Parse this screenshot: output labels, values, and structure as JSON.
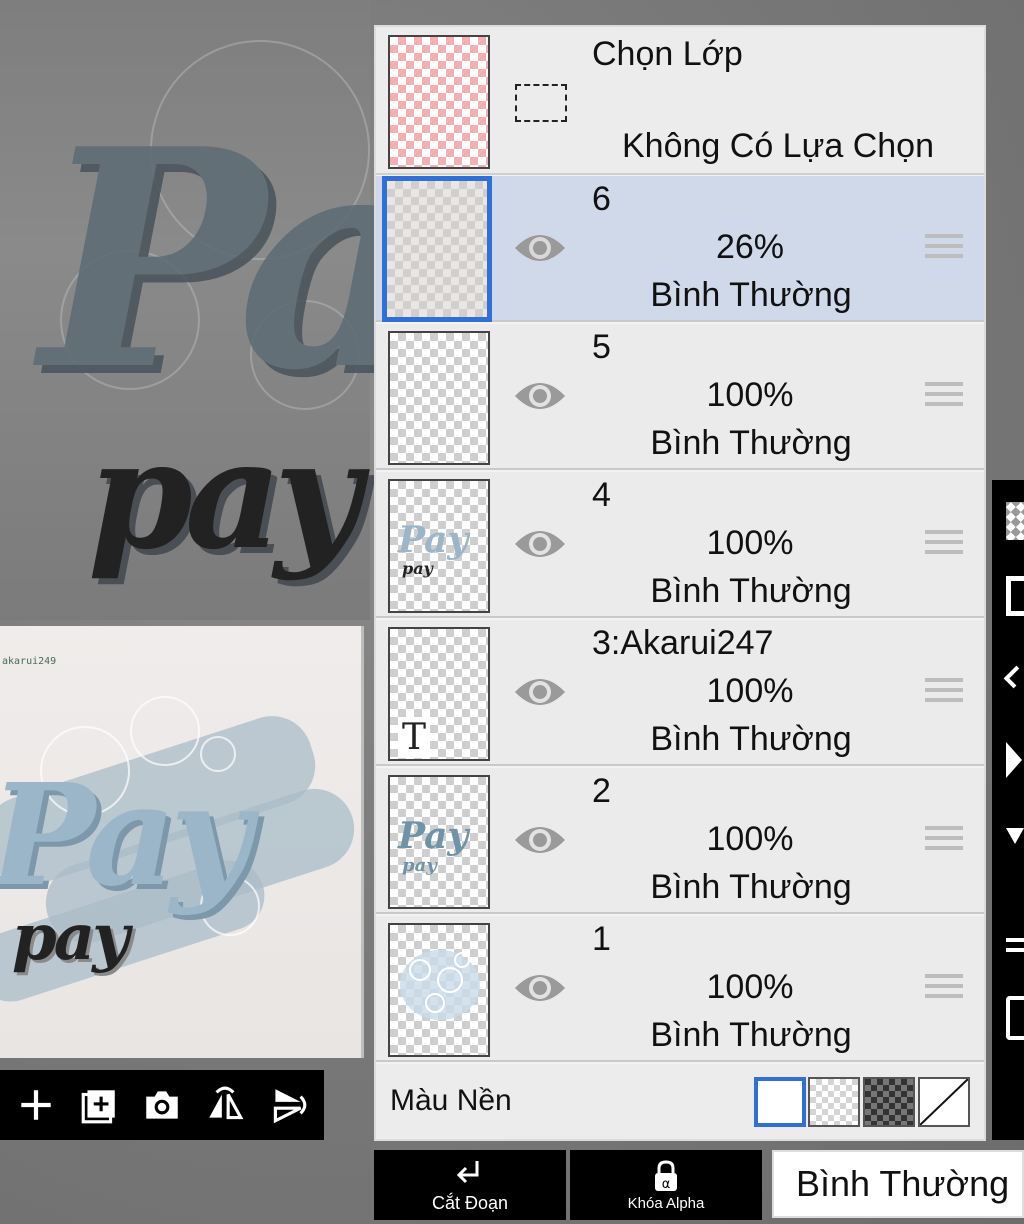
{
  "layer_panel": {
    "selection": {
      "title": "Chọn Lớp",
      "status": "Không Có Lựa Chọn"
    },
    "layers": [
      {
        "name": "6",
        "opacity": "26%",
        "blend": "Bình Thường",
        "active": true
      },
      {
        "name": "5",
        "opacity": "100%",
        "blend": "Bình Thường",
        "active": false
      },
      {
        "name": "4",
        "opacity": "100%",
        "blend": "Bình Thường",
        "active": false
      },
      {
        "name": "3:Akarui247",
        "opacity": "100%",
        "blend": "Bình Thường",
        "active": false
      },
      {
        "name": "2",
        "opacity": "100%",
        "blend": "Bình Thường",
        "active": false
      },
      {
        "name": "1",
        "opacity": "100%",
        "blend": "Bình Thường",
        "active": false
      }
    ],
    "background": {
      "label": "Màu Nền",
      "swatches": [
        "white",
        "transparent",
        "dark-checker",
        "none"
      ]
    }
  },
  "bottom_bar": {
    "clip_label": "Cắt Đoạn",
    "alpha_lock_label": "Khóa Alpha",
    "blend_mode": "Bình Thường"
  },
  "preview_toolbar": {
    "icons": [
      "add-icon",
      "add-layer-icon",
      "camera-icon",
      "flip-horizontal-icon",
      "flip-vertical-icon"
    ]
  },
  "thumbnails": {
    "layer4_text_large": "Pay",
    "layer4_text_small": "pay",
    "layer3_glyph": "T",
    "layer2_text_large": "Pay",
    "layer2_text_small": "pay"
  },
  "canvas": {
    "artwork_large": "Pay",
    "artwork_small": "pay",
    "preview_credit": "akarui249",
    "preview_large": "Pay",
    "preview_small": "pay"
  },
  "colors": {
    "active_row": "#cfd9ea",
    "active_border": "#2f6fd6",
    "panel_bg": "#ebebeb"
  }
}
